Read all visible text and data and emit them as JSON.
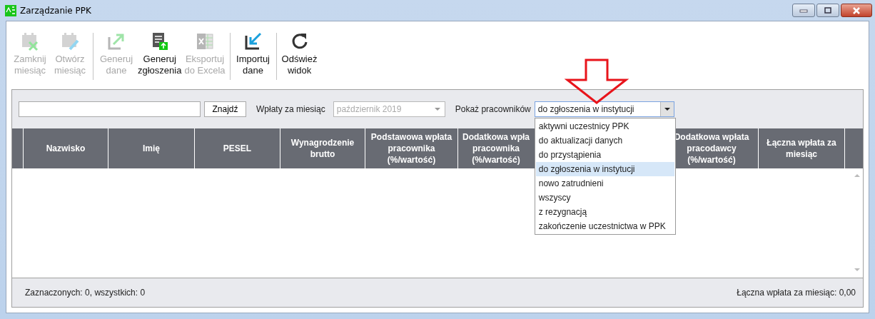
{
  "window": {
    "title": "Zarządzanie PPK"
  },
  "toolbar": {
    "groups": [
      [
        {
          "label": "Zamknij\nmiesiąc",
          "kind": "calendar-close",
          "disabled": true
        },
        {
          "label": "Otwórz\nmiesiąc",
          "kind": "calendar-edit",
          "disabled": true
        }
      ],
      [
        {
          "label": "Generuj\ndane",
          "kind": "export",
          "disabled": true
        },
        {
          "label": "Generuj\nzgłoszenia",
          "kind": "document-upload",
          "disabled": false
        },
        {
          "label": "Eksportuj\ndo Excela",
          "kind": "spreadsheet",
          "disabled": true
        }
      ],
      [
        {
          "label": "Importuj\ndane",
          "kind": "import",
          "disabled": false
        }
      ],
      [
        {
          "label": "Odśwież\nwidok",
          "kind": "refresh",
          "disabled": false
        }
      ]
    ]
  },
  "filters": {
    "find_button": "Znajdź",
    "month_label": "Wpłaty za miesiąc",
    "month_select": {
      "value": "październik 2019",
      "disabled": true
    },
    "show_label": "Pokaż pracowników",
    "show_select": {
      "value": "do zgłoszenia w instytucji",
      "open": true,
      "options": [
        {
          "label": "aktywni uczestnicy PPK",
          "selected": false
        },
        {
          "label": "do aktualizacji danych",
          "selected": false
        },
        {
          "label": "do przystąpienia",
          "selected": false
        },
        {
          "label": "do zgłoszenia w instytucji",
          "selected": true
        },
        {
          "label": "nowo zatrudnieni",
          "selected": false
        },
        {
          "label": "wszyscy",
          "selected": false
        },
        {
          "label": "z rezygnacją",
          "selected": false
        },
        {
          "label": "zakończenie uczestnictwa w PPK",
          "selected": false
        }
      ]
    }
  },
  "table": {
    "columns": [
      {
        "label": "Nazwisko"
      },
      {
        "label": "Imię"
      },
      {
        "label": "PESEL"
      },
      {
        "label": "Wynagrodzenie\nbrutto"
      },
      {
        "label": "Podstawowa wpłata\npracownika\n(%/wartość)"
      },
      {
        "label": "Dodatkowa wpła\npracownika\n(%/wartość)"
      },
      {
        "label": "Dodatkowa wpłata\npracodawcy\n(%/wartość)"
      },
      {
        "label": "Łączna wpłata za\nmiesiąc"
      }
    ]
  },
  "footer": {
    "selection_summary": "Zaznaczonych: 0, wszystkich: 0",
    "total": "Łączna wpłata za miesiąc: 0,00"
  }
}
